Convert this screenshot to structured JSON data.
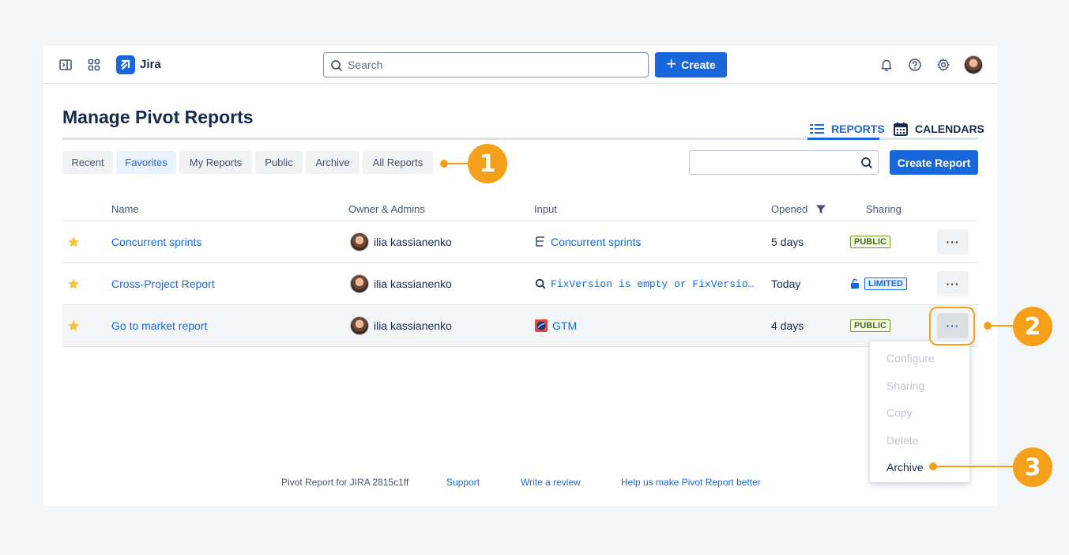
{
  "app": {
    "name": "Jira"
  },
  "topbar": {
    "search_placeholder": "Search",
    "create_label": "Create"
  },
  "page": {
    "title": "Manage Pivot Reports"
  },
  "view_tabs": {
    "reports": "REPORTS",
    "calendars": "CALENDARS"
  },
  "filters": [
    "Recent",
    "Favorites",
    "My Reports",
    "Public",
    "Archive",
    "All Reports"
  ],
  "active_filter": "Favorites",
  "create_report_label": "Create Report",
  "table": {
    "headers": {
      "name": "Name",
      "owner": "Owner & Admins",
      "input": "Input",
      "opened": "Opened",
      "sharing": "Sharing"
    },
    "rows": [
      {
        "name": "Concurrent sprints",
        "owner": "ilia kassianenko",
        "input": "Concurrent sprints",
        "input_icon": "board-icon",
        "opened": "5 days",
        "sharing": "PUBLIC"
      },
      {
        "name": "Cross-Project Report",
        "owner": "ilia kassianenko",
        "input": "FixVersion is empty or FixVersio…",
        "input_icon": "search-icon",
        "opened": "Today",
        "sharing": "LIMITED"
      },
      {
        "name": "Go to market report",
        "owner": "ilia kassianenko",
        "input": "GTM",
        "input_icon": "project-icon",
        "opened": "4 days",
        "sharing": "PUBLIC"
      }
    ]
  },
  "more_label": "···",
  "menu": {
    "configure": "Configure",
    "sharing": "Sharing",
    "copy": "Copy",
    "delete": "Delete",
    "archive": "Archive"
  },
  "footer": {
    "version": "Pivot Report for JIRA 2815c1ff",
    "support": "Support",
    "review": "Write a review",
    "help": "Help us make Pivot Report better"
  },
  "callouts": [
    "1",
    "2",
    "3"
  ],
  "colors": {
    "accent": "#1868db",
    "callout": "#f5a01a",
    "star": "#f6c342"
  }
}
